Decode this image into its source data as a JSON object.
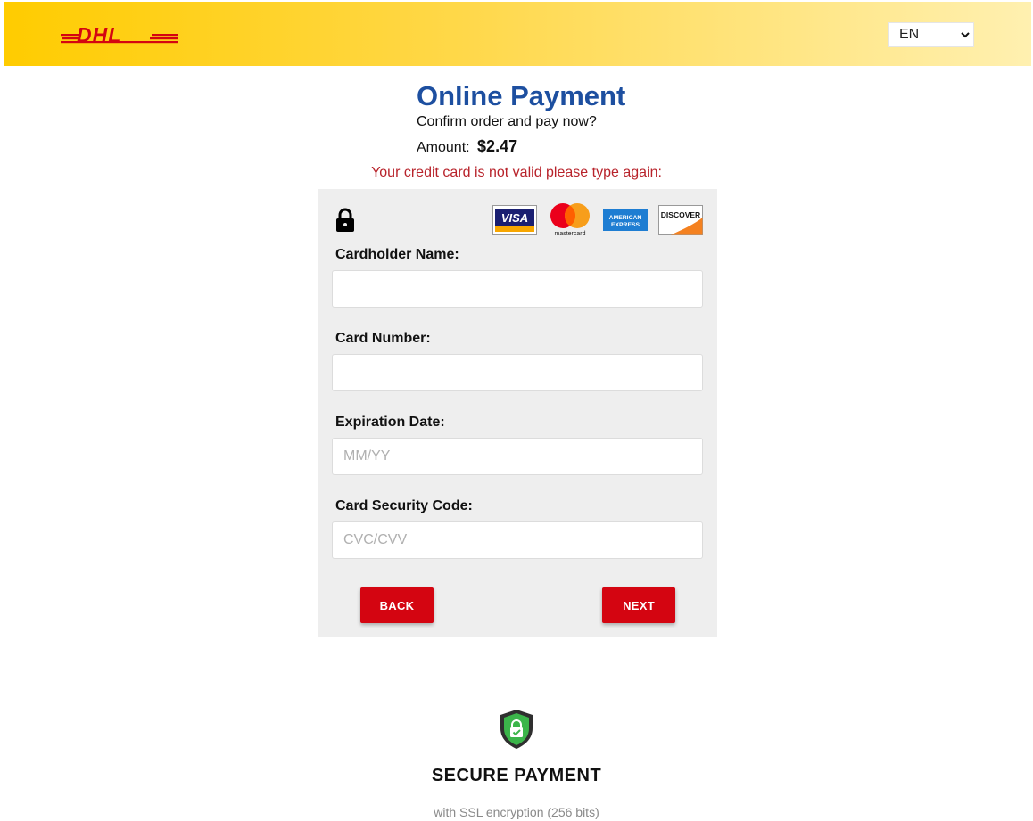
{
  "header": {
    "logo_text": "DHL",
    "language": {
      "selected": "EN",
      "icon": "chevron-down-icon"
    },
    "colors": {
      "brand_yellow": "#ffcc00",
      "brand_red": "#d40511"
    }
  },
  "main": {
    "title": "Online Payment",
    "subtitle": "Confirm order and pay now?",
    "amount_label": "Amount:",
    "amount_value": "$2.47",
    "error_message": "Your credit card is not valid please type again:"
  },
  "card_form": {
    "lock_icon": "lock-icon",
    "accepted_cards": [
      "VISA",
      "mastercard",
      "AMERICAN EXPRESS",
      "DISCOVER"
    ],
    "fields": [
      {
        "label": "Cardholder Name:",
        "value": "",
        "placeholder": ""
      },
      {
        "label": "Card Number:",
        "value": "",
        "placeholder": ""
      },
      {
        "label": "Expiration Date:",
        "value": "",
        "placeholder": "MM/YY"
      },
      {
        "label": "Card Security Code:",
        "value": "",
        "placeholder": "CVC/CVV"
      }
    ],
    "back_label": "BACK",
    "next_label": "NEXT"
  },
  "footer": {
    "shield_icon": "shield-lock-icon",
    "secure_title": "SECURE PAYMENT",
    "secure_subtitle": "with SSL encryption (256 bits)"
  }
}
